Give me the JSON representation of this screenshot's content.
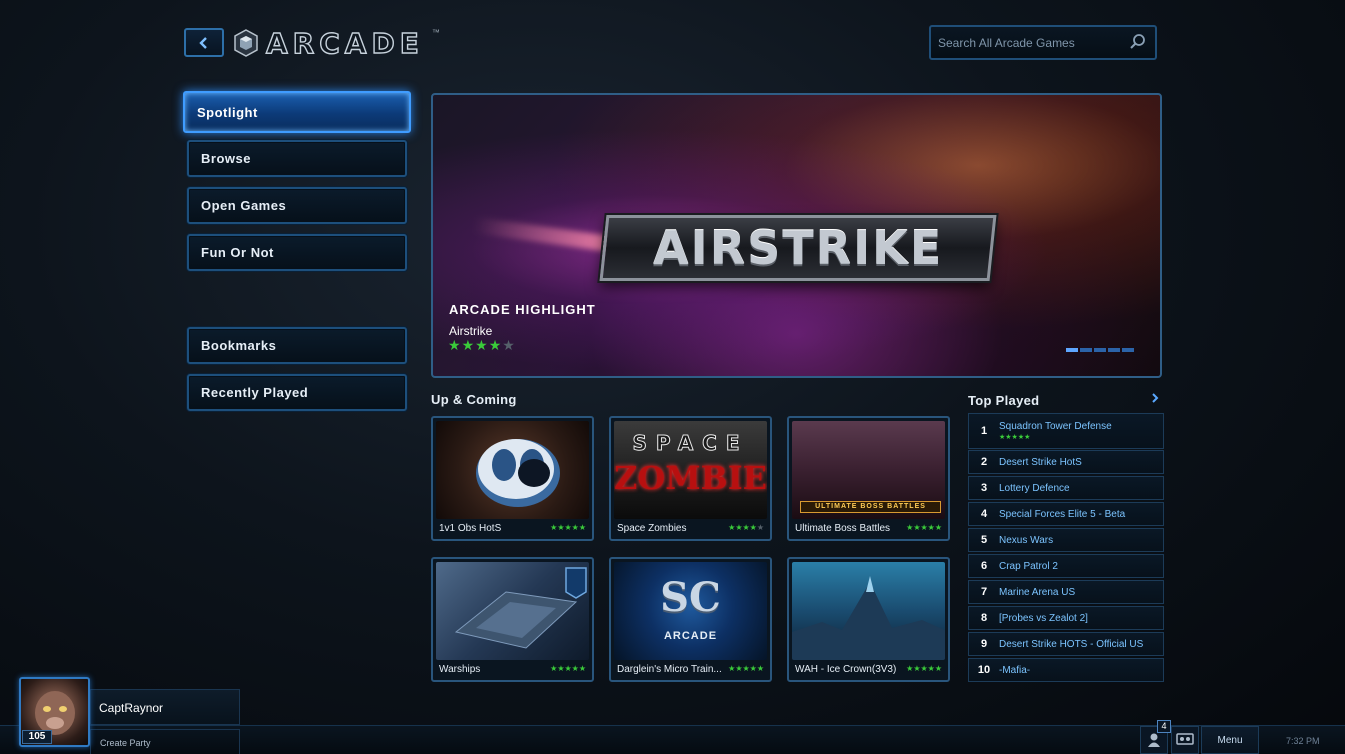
{
  "header": {
    "title": "ARCADE",
    "trademark": "™",
    "search_placeholder": "Search All Arcade Games"
  },
  "nav": {
    "items": [
      {
        "label": "Spotlight",
        "active": true
      },
      {
        "label": "Browse",
        "active": false
      },
      {
        "label": "Open Games",
        "active": false
      },
      {
        "label": "Fun Or Not",
        "active": false
      },
      {
        "label": "Bookmarks",
        "active": false
      },
      {
        "label": "Recently Played",
        "active": false
      }
    ]
  },
  "banner": {
    "game_logo": "AIRSTRIKE",
    "tag": "ARCADE HIGHLIGHT",
    "game": "Airstrike",
    "rating": 4,
    "rating_max": 5
  },
  "up_coming": {
    "title": "Up & Coming",
    "cards": [
      {
        "name": "1v1 Obs HotS",
        "rating": 5,
        "image": "obs-logo"
      },
      {
        "name": "Space Zombies",
        "rating": 4,
        "image": "space-zombies",
        "art_top": "SPACE",
        "art_bottom": "ZOMBIES"
      },
      {
        "name": "Ultimate Boss Battles",
        "rating": 5,
        "image": "boss-battles",
        "art_label": "ULTIMATE BOSS BATTLES"
      },
      {
        "name": "Warships",
        "rating": 5,
        "image": "warships"
      },
      {
        "name": "Darglein's Micro Train...",
        "rating": 5,
        "image": "sc-arcade",
        "art_label": "ARCADE"
      },
      {
        "name": "WAH - Ice Crown(3V3)",
        "rating": 5,
        "image": "ice-crown"
      }
    ]
  },
  "top_played": {
    "title": "Top Played",
    "rows": [
      {
        "rank": "1",
        "name": "Squadron Tower Defense",
        "rating": 5
      },
      {
        "rank": "2",
        "name": "Desert Strike HotS"
      },
      {
        "rank": "3",
        "name": "Lottery Defence"
      },
      {
        "rank": "4",
        "name": "Special Forces Elite 5 - Beta"
      },
      {
        "rank": "5",
        "name": "Nexus Wars"
      },
      {
        "rank": "6",
        "name": "Crap Patrol 2"
      },
      {
        "rank": "7",
        "name": "Marine Arena US"
      },
      {
        "rank": "8",
        "name": "[Probes vs Zealot 2]"
      },
      {
        "rank": "9",
        "name": "Desert Strike HOTS - Official US"
      },
      {
        "rank": "10",
        "name": "-Mafia-"
      }
    ]
  },
  "player": {
    "name": "CaptRaynor",
    "level": "105",
    "create_party": "Create Party"
  },
  "footer": {
    "friends_count": "4",
    "menu_label": "Menu",
    "time": "7:32 PM"
  },
  "colors": {
    "accent": "#3f9cff",
    "star": "#3acb3a",
    "link": "#7cc4ff"
  }
}
